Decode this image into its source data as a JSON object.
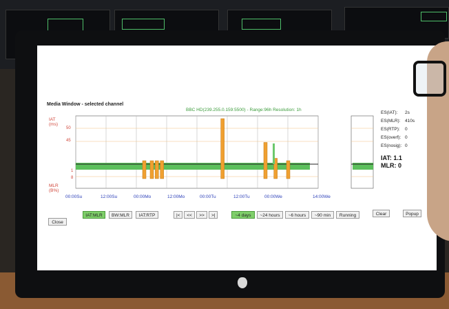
{
  "window": {
    "title": "Media Window - selected channel",
    "chart_info": "BBC HD(239.255.0.159:5500) - Range:96h Resolution: 1h"
  },
  "colors": {
    "iat_axis": "#d0463a",
    "time_axis": "#2a3eb8",
    "mlr_band": "#5cc05c",
    "iat_bar": "#f0a030",
    "active_button": "#7fcf6a"
  },
  "chart_data": {
    "type": "bar",
    "y_top_label": "IAT\n(ms)",
    "y_bottom_label": "MLR\n(B%)",
    "y_ticks": [
      "50",
      "45",
      "1",
      "8"
    ],
    "x_ticks": [
      "00:00Su",
      "12:00Su",
      "00:00Mo",
      "12:00Mo",
      "00:00Tu",
      "12:00Tu",
      "00:00We",
      "14:00We"
    ],
    "iat_baseline_ms": 1,
    "series": [
      {
        "name": "IAT",
        "values": [
          3,
          3,
          2,
          2,
          60,
          30,
          10,
          3
        ],
        "positions_h": [
          27,
          30,
          32,
          34,
          58,
          75,
          79,
          84
        ]
      },
      {
        "name": "MLR",
        "values": [
          0,
          0,
          0,
          0,
          0,
          0,
          0,
          0
        ]
      }
    ],
    "grid": true
  },
  "stats": {
    "items": [
      {
        "label": "ES(IAT):",
        "value": "2s"
      },
      {
        "label": "ES(MLR):",
        "value": "410s"
      },
      {
        "label": "ES(RTP):",
        "value": "0"
      },
      {
        "label": "ES(overf):",
        "value": "0"
      },
      {
        "label": "ES(nosig):",
        "value": "0"
      }
    ],
    "iat_current": "IAT: 1.1",
    "mlr_current": "MLR: 0"
  },
  "buttons": {
    "close": "Close",
    "iat_mlr": "IAT:MLR",
    "bw_mlr": "BW:MLR",
    "iat_rtp": "IAT:RTP",
    "first": "|<",
    "prev": "<<",
    "next": ">>",
    "last": ">|",
    "range_4d": "~4 days",
    "range_24h": "~24 hours",
    "range_6h": "~6 hours",
    "range_90m": "~90 min",
    "running": "Running",
    "clear": "Clear",
    "popup": "Popup"
  }
}
